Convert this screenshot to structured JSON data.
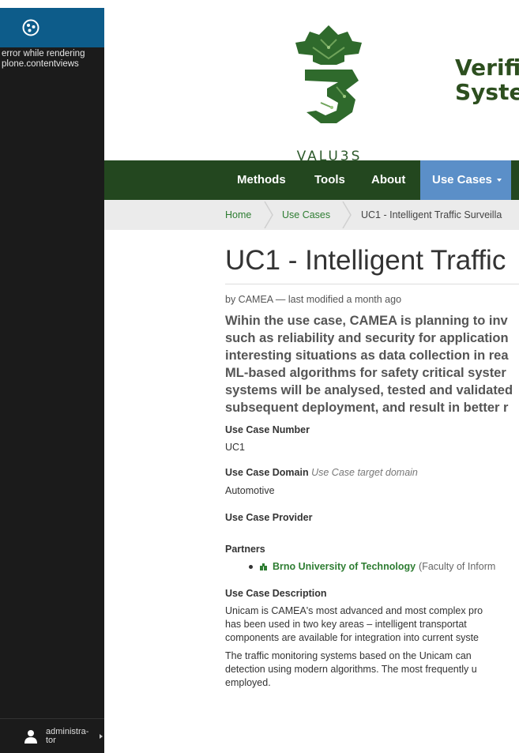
{
  "toolbar": {
    "error_line1": "error while rendering",
    "error_line2": "plone.contentviews",
    "user_line1": "administra-",
    "user_line2": "tor"
  },
  "header": {
    "logo_text": "VALU3S",
    "title_line1": "Verifi",
    "title_line2": "Syste"
  },
  "nav": {
    "items": [
      "Methods",
      "Tools",
      "About",
      "Use Cases"
    ]
  },
  "breadcrumbs": {
    "home": "Home",
    "use_cases": "Use Cases",
    "current": "UC1 - Intelligent Traffic Surveilla"
  },
  "content": {
    "title": "UC1 - Intelligent Traffic",
    "byline": "by CAMEA — last modified a month ago",
    "lead": [
      "Wihin the use case, CAMEA is planning to inv",
      "such as reliability and security for application",
      "interesting situations as data collection in rea",
      "ML-based algorithms for safety critical syster",
      "systems will be analysed, tested and validated",
      "subsequent deployment, and result in better r"
    ],
    "use_case_number_label": "Use Case Number",
    "use_case_number": "UC1",
    "use_case_domain_label": "Use Case Domain",
    "use_case_domain_help": "Use Case target domain",
    "use_case_domain": "Automotive",
    "use_case_provider_label": "Use Case Provider",
    "partners_label": "Partners",
    "partner_name": "Brno University of Technology",
    "partner_extra": "(Faculty of Inform",
    "description_label": "Use Case Description",
    "desc_p1": [
      "Unicam is CAMEA's most advanced and most complex pro",
      "has been used in two key areas – intelligent transportat",
      "components are available for integration into current syste"
    ],
    "desc_p2": [
      "The traffic monitoring systems based on the Unicam can",
      "detection using modern algorithms. The most frequently u",
      "employed."
    ]
  },
  "colors": {
    "toolbar_bg": "#1b1b1b",
    "toolbar_top": "#0d5c8a",
    "nav_bg": "#23471f",
    "nav_active": "#5b8fc8",
    "link_green": "#2e7d32",
    "brand_green": "#2d5a2b"
  }
}
